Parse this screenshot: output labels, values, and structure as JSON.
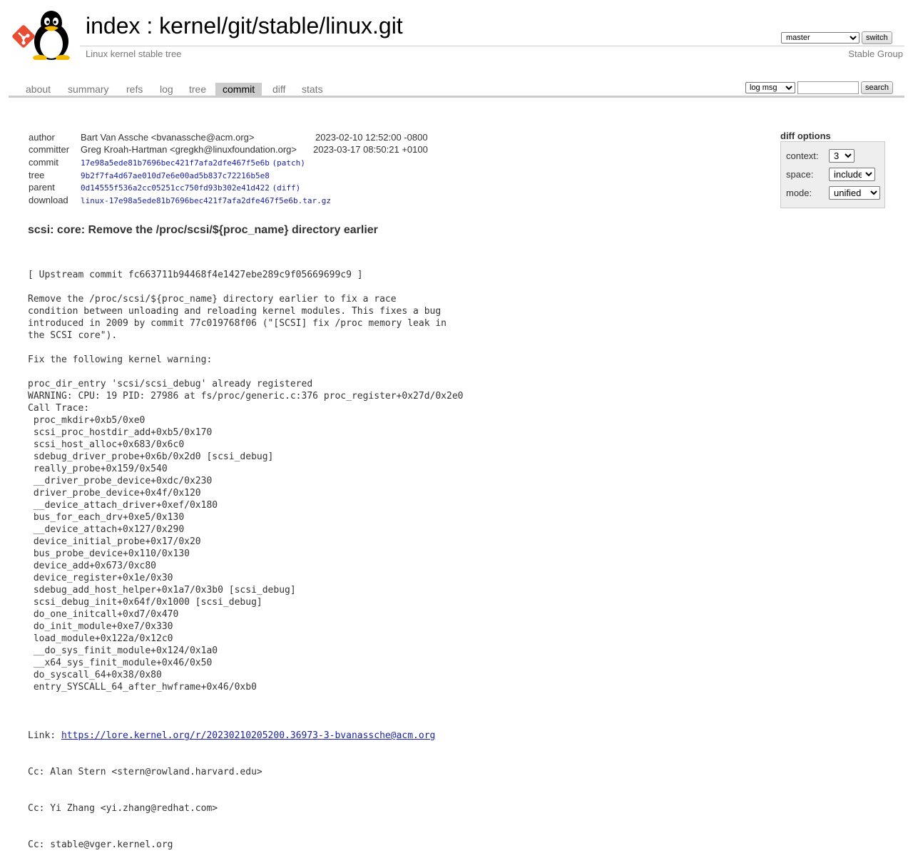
{
  "header": {
    "title_index": "index",
    "title_separator": " : ",
    "title_path": "kernel/git/stable/linux.git",
    "description": "Linux kernel stable tree",
    "owner": "Stable Group",
    "branch_selected": "master",
    "switch_label": "switch"
  },
  "tabs": [
    {
      "label": "about",
      "active": false
    },
    {
      "label": "summary",
      "active": false
    },
    {
      "label": "refs",
      "active": false
    },
    {
      "label": "log",
      "active": false
    },
    {
      "label": "tree",
      "active": false
    },
    {
      "label": "commit",
      "active": true
    },
    {
      "label": "diff",
      "active": false
    },
    {
      "label": "stats",
      "active": false
    }
  ],
  "search": {
    "mode_selected": "log msg",
    "query": "",
    "button_label": "search"
  },
  "commit_info": {
    "author": {
      "label": "author",
      "value": "Bart Van Assche <bvanassche@acm.org>",
      "date": "2023-02-10 12:52:00 -0800"
    },
    "committer": {
      "label": "committer",
      "value": "Greg Kroah-Hartman <gregkh@linuxfoundation.org>",
      "date": "2023-03-17 08:50:21 +0100"
    },
    "commit": {
      "label": "commit",
      "hash": "17e98a5ede81b7696bec421f7afa2dfe467f5e6b",
      "extra": "patch"
    },
    "tree": {
      "label": "tree",
      "hash": "9b2f7fa4d67ae010d7e6e00ad5b837c72216b5e8"
    },
    "parent": {
      "label": "parent",
      "hash": "0d14555f536a2cc05251cc750fd93b302e41d422",
      "extra": "diff"
    },
    "download": {
      "label": "download",
      "file": "linux-17e98a5ede81b7696bec421f7afa2dfe467f5e6b.tar.gz"
    }
  },
  "diff_options": {
    "title": "diff options",
    "context_label": "context:",
    "context_value": "3",
    "space_label": "space:",
    "space_value": "include",
    "mode_label": "mode:",
    "mode_value": "unified"
  },
  "commit_subject": "scsi: core: Remove the /proc/scsi/${proc_name} directory earlier",
  "commit_message_lines": [
    "[ Upstream commit fc663711b94468f4e1427ebe289c9f05669699c9 ]",
    "",
    "Remove the /proc/scsi/${proc_name} directory earlier to fix a race",
    "condition between unloading and reloading kernel modules. This fixes a bug",
    "introduced in 2009 by commit 77c019768f06 (\"[SCSI] fix /proc memory leak in",
    "the SCSI core\").",
    "",
    "Fix the following kernel warning:",
    "",
    "proc_dir_entry 'scsi/scsi_debug' already registered",
    "WARNING: CPU: 19 PID: 27986 at fs/proc/generic.c:376 proc_register+0x27d/0x2e0",
    "Call Trace:",
    " proc_mkdir+0xb5/0xe0",
    " scsi_proc_hostdir_add+0xb5/0x170",
    " scsi_host_alloc+0x683/0x6c0",
    " sdebug_driver_probe+0x6b/0x2d0 [scsi_debug]",
    " really_probe+0x159/0x540",
    " __driver_probe_device+0xdc/0x230",
    " driver_probe_device+0x4f/0x120",
    " __device_attach_driver+0xef/0x180",
    " bus_for_each_drv+0xe5/0x130",
    " __device_attach+0x127/0x290",
    " device_initial_probe+0x17/0x20",
    " bus_probe_device+0x110/0x130",
    " device_add+0x673/0xc80",
    " device_register+0x1e/0x30",
    " sdebug_add_host_helper+0x1a7/0x3b0 [scsi_debug]",
    " scsi_debug_init+0x64f/0x1000 [scsi_debug]",
    " do_one_initcall+0xd7/0x470",
    " do_init_module+0xe7/0x330",
    " load_module+0x122a/0x12c0",
    " __do_sys_finit_module+0x124/0x1a0",
    " __x64_sys_finit_module+0x46/0x50",
    " do_syscall_64+0x38/0x80",
    " entry_SYSCALL_64_after_hwframe+0x46/0xb0",
    ""
  ],
  "link_line": {
    "prefix": "Link: ",
    "url": "https://lore.kernel.org/r/20230210205200.36973-3-bvanassche@acm.org"
  },
  "cc_lines": [
    "Cc: Alan Stern <stern@rowland.harvard.edu>",
    "Cc: Yi Zhang <yi.zhang@redhat.com>",
    "Cc: stable@vger.kernel.org"
  ],
  "icons": {
    "git_logo": "git-logo-icon",
    "tux_logo": "tux-penguin-icon"
  },
  "colors": {
    "link": "#1a22a8",
    "active_tab_bg": "#cccccc",
    "muted_text": "#777777",
    "git_logo": "#e84c32"
  }
}
